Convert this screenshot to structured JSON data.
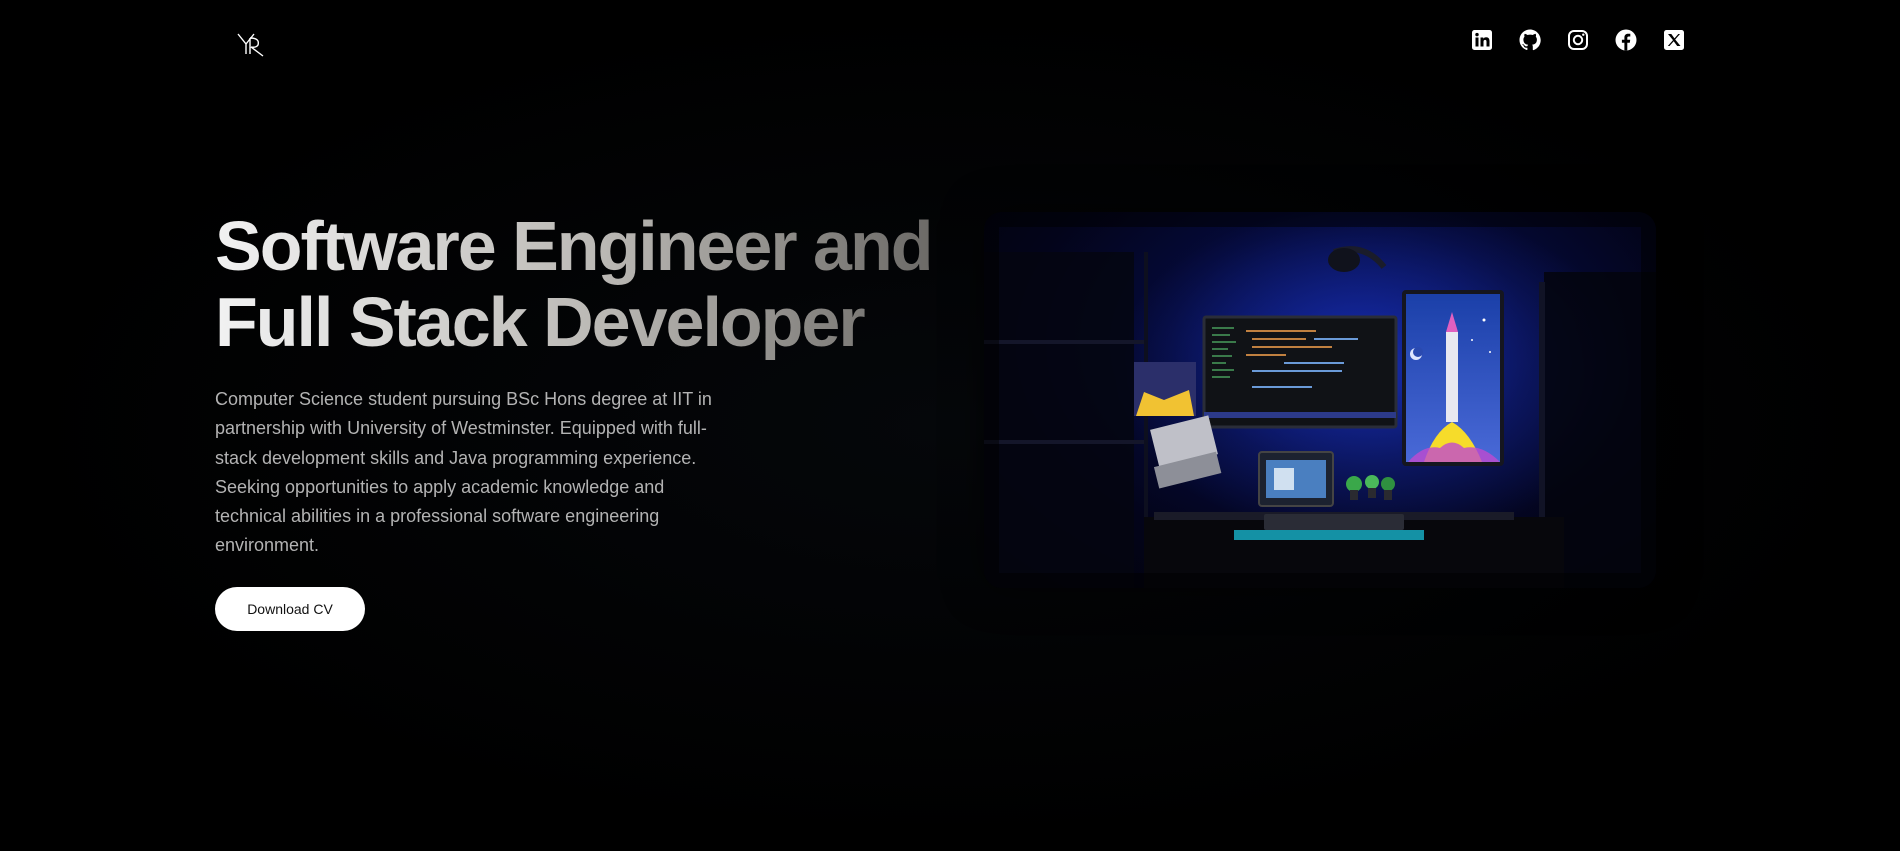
{
  "header": {
    "logo": {
      "text": "YR",
      "icon": "monogram-logo"
    },
    "social": [
      {
        "name": "LinkedIn",
        "icon": "linkedin-icon"
      },
      {
        "name": "GitHub",
        "icon": "github-icon"
      },
      {
        "name": "Instagram",
        "icon": "instagram-icon"
      },
      {
        "name": "Facebook",
        "icon": "facebook-icon"
      },
      {
        "name": "X",
        "icon": "x-icon"
      }
    ]
  },
  "hero": {
    "headline_line1": "Software Engineer and",
    "headline_line2": "Full Stack Developer",
    "description": "Computer Science student pursuing BSc Hons degree at IIT in partnership with University of Westminster. Equipped with full-stack development skills and Java programming experience. Seeking opportunities to apply academic knowledge and technical abilities in a professional software engineering environment.",
    "cv_button_label": "Download CV",
    "image": {
      "icon": "desk-setup-photo"
    }
  },
  "colors": {
    "background": "#000000",
    "text_primary": "#f2f2f2",
    "text_muted": "#b3b3b3",
    "button_bg": "#ffffff",
    "button_text": "#111111",
    "image_accent": "#0c1a7a"
  }
}
